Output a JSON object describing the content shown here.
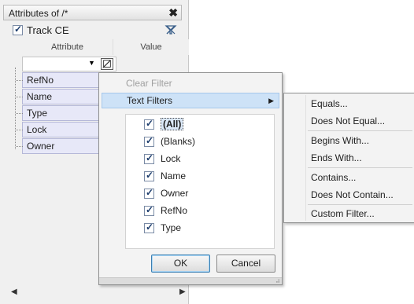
{
  "panel": {
    "title": "Attributes of /*",
    "close_glyph": "✖",
    "track_label": "Track CE",
    "track_checked": true,
    "clear_filter_icon": "filter-clear-icon",
    "columns": {
      "attribute": "Attribute",
      "value": "Value"
    },
    "rows": [
      "RefNo",
      "Name",
      "Type",
      "Lock",
      "Owner"
    ],
    "scroll_left": "◀",
    "scroll_right": "▶"
  },
  "dropdown": {
    "clear_filter": "Clear Filter",
    "text_filters": "Text Filters",
    "submenu_arrow": "▶",
    "items": [
      "(All)",
      "(Blanks)",
      "Lock",
      "Name",
      "Owner",
      "RefNo",
      "Type"
    ],
    "ok": "OK",
    "cancel": "Cancel",
    "grip": "⠴"
  },
  "submenu": {
    "groups": [
      [
        "Equals...",
        "Does Not Equal..."
      ],
      [
        "Begins With...",
        "Ends With..."
      ],
      [
        "Contains...",
        "Does Not Contain..."
      ],
      [
        "Custom Filter..."
      ]
    ]
  },
  "colors": {
    "row_bg": "#e7e8f8",
    "hover_bg": "#cde2f7",
    "accent": "#3c7fb1"
  }
}
